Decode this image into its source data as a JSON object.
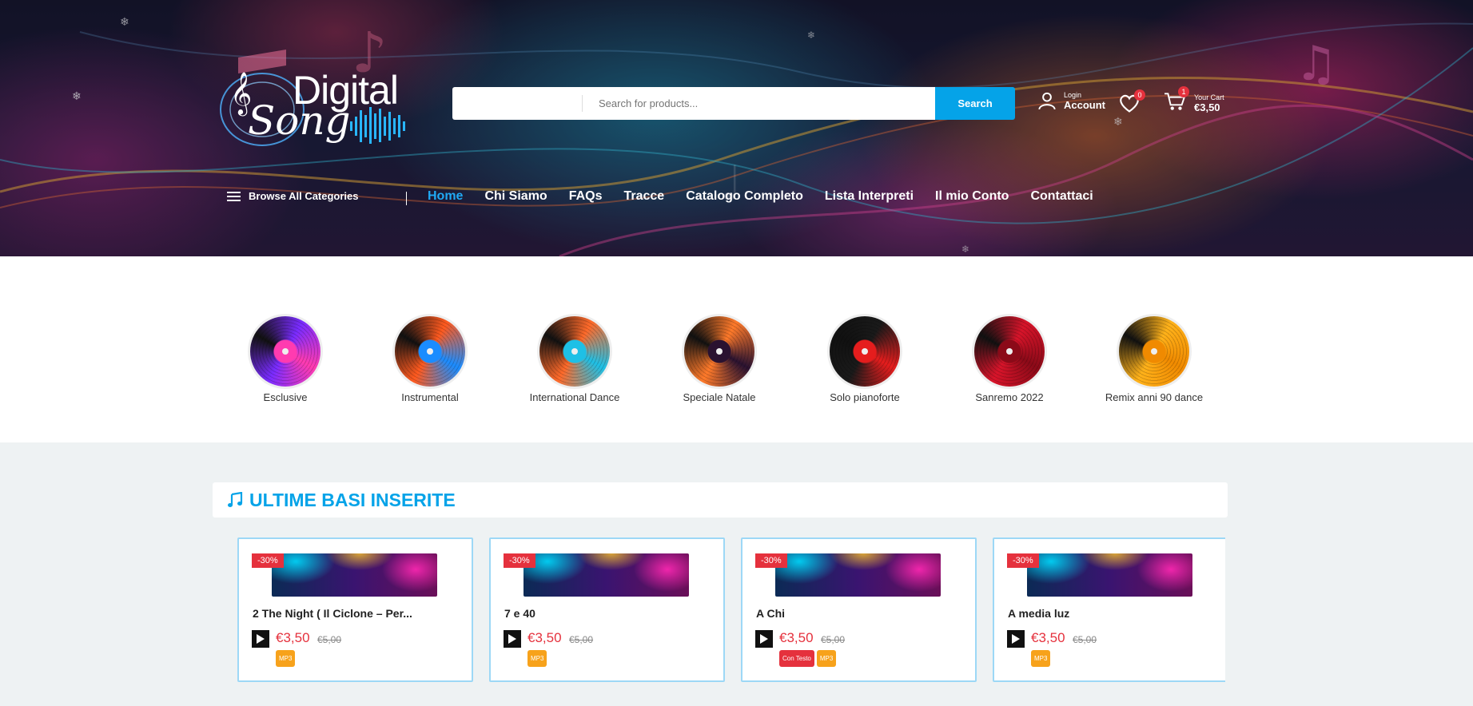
{
  "header": {
    "logo_text_main": "Digital",
    "logo_text_script": "Song",
    "search": {
      "placeholder": "Search for products...",
      "button_label": "Search"
    },
    "account": {
      "small_label": "Login",
      "big_label": "Account"
    },
    "wishlist": {
      "count": "0"
    },
    "cart": {
      "count": "1",
      "small_label": "Your Cart",
      "total": "€3,50"
    }
  },
  "nav": {
    "browse_label": "Browse All Categories",
    "items": [
      {
        "label": "Home",
        "active": true
      },
      {
        "label": "Chi Siamo"
      },
      {
        "label": "FAQs"
      },
      {
        "label": "Tracce"
      },
      {
        "label": "Catalogo Completo"
      },
      {
        "label": "Lista Interpreti"
      },
      {
        "label": "Il mio Conto"
      },
      {
        "label": "Contattaci"
      }
    ]
  },
  "categories": [
    {
      "label": "Esclusive",
      "color_a": "#7a2cff",
      "color_b": "#ff3bb0"
    },
    {
      "label": "Instrumental",
      "color_a": "#ff5a1f",
      "color_b": "#1a8cff"
    },
    {
      "label": "International Dance",
      "color_a": "#ff6a2a",
      "color_b": "#1ec0e6"
    },
    {
      "label": "Speciale Natale",
      "color_a": "#ff7a2a",
      "color_b": "#2a1230"
    },
    {
      "label": "Solo pianoforte",
      "color_a": "#1a1a1a",
      "color_b": "#e51d1d"
    },
    {
      "label": "Sanremo 2022",
      "color_a": "#d8142a",
      "color_b": "#8b0a18"
    },
    {
      "label": "Remix anni 90 dance",
      "color_a": "#ffb21a",
      "color_b": "#f08a00"
    }
  ],
  "latest": {
    "title": "ULTIME BASI INSERITE",
    "products": [
      {
        "discount": "-30%",
        "title": "2 The Night ( Il Ciclone – Per...",
        "price": "€3,50",
        "old_price": "€5,00",
        "tags": [
          {
            "label": "MP3",
            "color": "orange"
          }
        ]
      },
      {
        "discount": "-30%",
        "title": "7 e 40",
        "price": "€3,50",
        "old_price": "€5,00",
        "tags": [
          {
            "label": "MP3",
            "color": "orange"
          }
        ]
      },
      {
        "discount": "-30%",
        "title": "A Chi",
        "price": "€3,50",
        "old_price": "€5,00",
        "tags": [
          {
            "label": "Con Testo",
            "color": "red"
          },
          {
            "label": "MP3",
            "color": "orange"
          }
        ]
      },
      {
        "discount": "-30%",
        "title": "A media luz",
        "price": "€3,50",
        "old_price": "€5,00",
        "tags": [
          {
            "label": "MP3",
            "color": "orange"
          }
        ]
      }
    ]
  },
  "colors": {
    "accent": "#05a3e8",
    "sale": "#e5313d",
    "tag_orange": "#f7a21b"
  }
}
